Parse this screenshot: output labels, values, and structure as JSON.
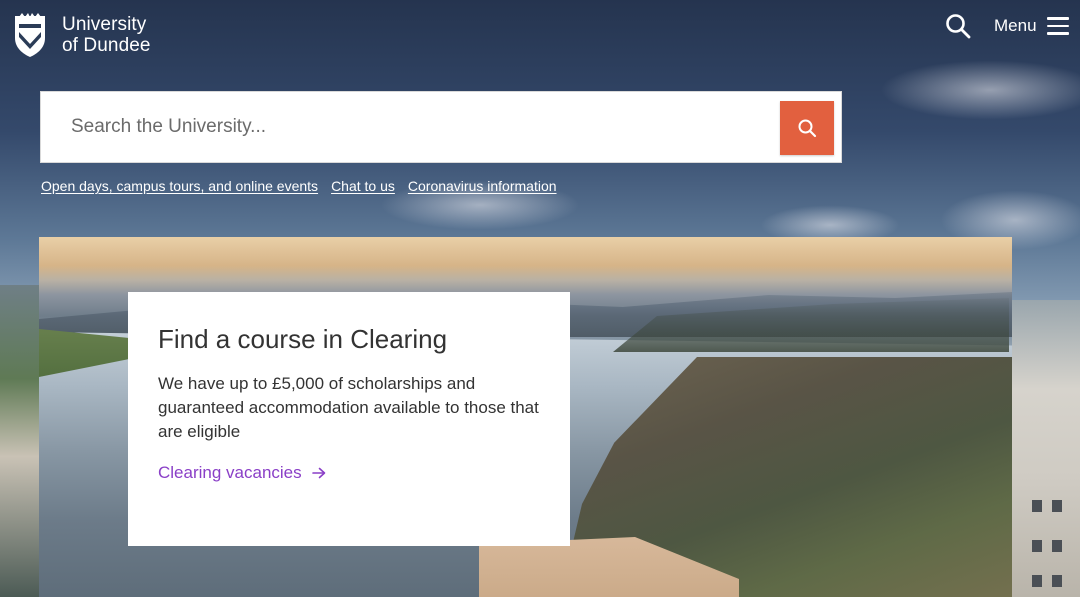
{
  "header": {
    "logo_line1": "University",
    "logo_line2": "of Dundee",
    "menu_label": "Menu"
  },
  "search": {
    "placeholder": "Search the University...",
    "submit_icon": "search-icon",
    "accent_color": "#e2603f"
  },
  "quick_links": [
    {
      "label": "Open days, campus tours, and online events"
    },
    {
      "label": "Chat to us"
    },
    {
      "label": "Coronavirus information"
    }
  ],
  "feature": {
    "title": "Find a course in Clearing",
    "text": "We have up to £5,000 of scholarships and guaranteed accommodation available to those that are eligible",
    "link_label": "Clearing vacancies",
    "link_icon": "arrow-right-icon",
    "link_color": "#8a3fc7"
  }
}
